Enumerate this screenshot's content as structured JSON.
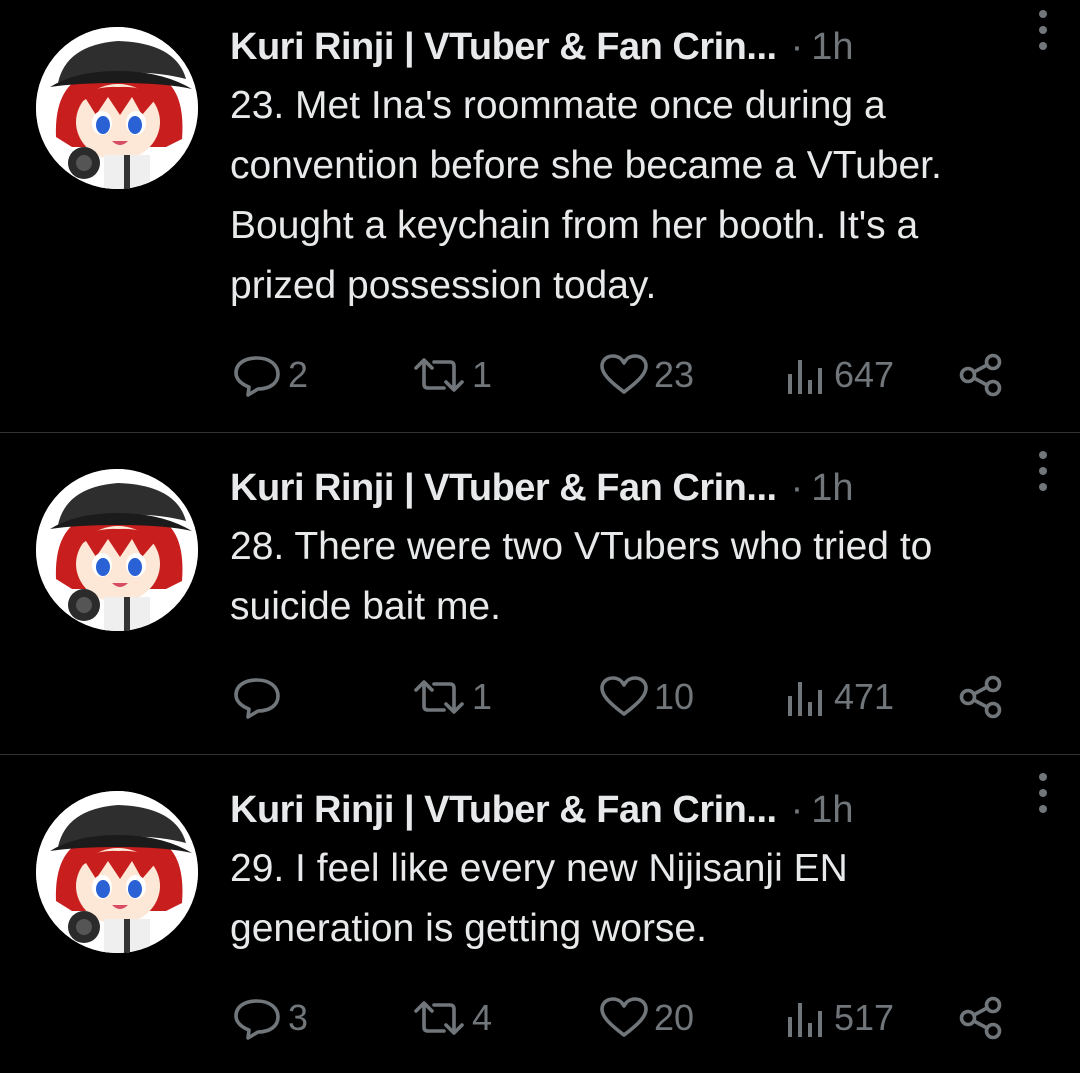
{
  "tweets": [
    {
      "author": "Kuri Rinji | VTuber & Fan Crin...",
      "separator": "·",
      "time": "1h",
      "text": "23. Met Ina's roommate once during a convention before she became a VTuber. Bought a keychain from her booth. It's a prized possession today.",
      "replies": "2",
      "retweets": "1",
      "likes": "23",
      "views": "647"
    },
    {
      "author": "Kuri Rinji | VTuber & Fan Crin...",
      "separator": "·",
      "time": "1h",
      "text": "28. There were two VTubers who tried to suicide bait me.",
      "replies": "",
      "retweets": "1",
      "likes": "10",
      "views": "471"
    },
    {
      "author": "Kuri Rinji | VTuber & Fan Crin...",
      "separator": "·",
      "time": "1h",
      "text": "29. I feel like every new Nijisanji EN generation is getting worse.",
      "replies": "3",
      "retweets": "4",
      "likes": "20",
      "views": "517"
    }
  ],
  "icons": {
    "reply": "reply-icon",
    "retweet": "retweet-icon",
    "like": "heart-icon",
    "views": "views-icon",
    "share": "share-icon",
    "more": "more-options-icon",
    "avatar": "avatar"
  },
  "colors": {
    "background": "#000000",
    "text_primary": "#e7e9ea",
    "text_secondary": "#71767b",
    "divider": "#2f3336"
  }
}
